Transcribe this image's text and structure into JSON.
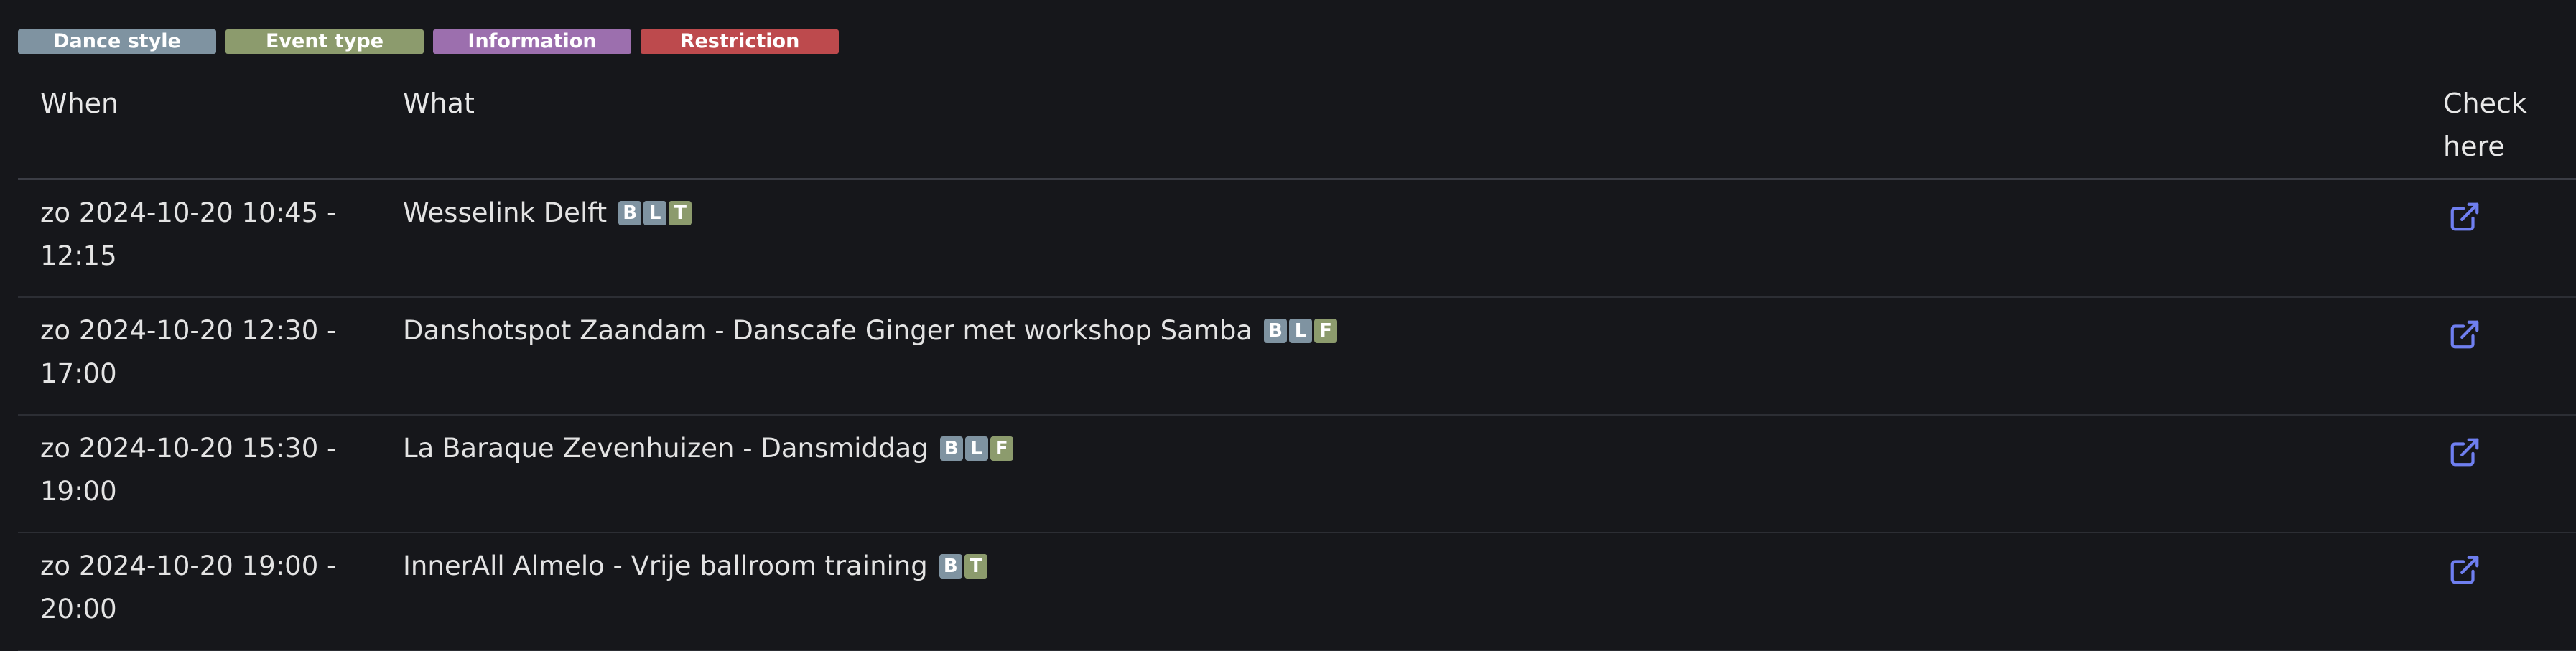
{
  "legend": [
    {
      "label": "Dance style",
      "color": "#7f93a1"
    },
    {
      "label": "Event type",
      "color": "#8c9b6d"
    },
    {
      "label": "Information",
      "color": "#9c6fae"
    },
    {
      "label": "Restriction",
      "color": "#bd4a4d"
    }
  ],
  "table": {
    "headers": {
      "when": "When",
      "what": "What",
      "check": "Check here"
    },
    "rows": [
      {
        "when": "zo 2024-10-20 10:45 - 12:15",
        "what": "Wesselink Delft",
        "badges": [
          {
            "letter": "B",
            "kind": "style"
          },
          {
            "letter": "L",
            "kind": "style"
          },
          {
            "letter": "T",
            "kind": "type"
          }
        ],
        "link_icon": "external-link-icon"
      },
      {
        "when": "zo 2024-10-20 12:30 - 17:00",
        "what": "Danshotspot Zaandam - Danscafe Ginger met workshop Samba",
        "badges": [
          {
            "letter": "B",
            "kind": "style"
          },
          {
            "letter": "L",
            "kind": "style"
          },
          {
            "letter": "F",
            "kind": "type"
          }
        ],
        "link_icon": "external-link-icon"
      },
      {
        "when": "zo 2024-10-20 15:30 - 19:00",
        "what": "La Baraque Zevenhuizen - Dansmiddag",
        "badges": [
          {
            "letter": "B",
            "kind": "style"
          },
          {
            "letter": "L",
            "kind": "style"
          },
          {
            "letter": "F",
            "kind": "type"
          }
        ],
        "link_icon": "external-link-icon"
      },
      {
        "when": "zo 2024-10-20 19:00 - 20:00",
        "what": "InnerAll Almelo - Vrije ballroom training",
        "badges": [
          {
            "letter": "B",
            "kind": "style"
          },
          {
            "letter": "T",
            "kind": "type"
          }
        ],
        "link_icon": "external-link-icon"
      }
    ]
  },
  "colors": {
    "background": "#16171b",
    "link": "#6f7ff0",
    "badge_style": "#7f93a1",
    "badge_type": "#8c9b6d"
  }
}
